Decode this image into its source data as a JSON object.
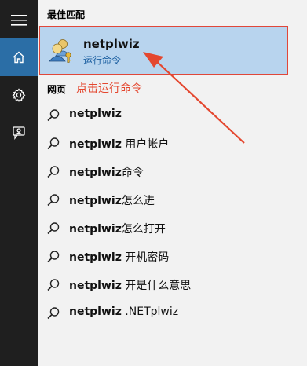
{
  "sections": {
    "best_match": "最佳匹配",
    "web": "网页"
  },
  "best_match": {
    "title": "netplwiz",
    "subtitle": "运行命令"
  },
  "annotation": "点击运行命令",
  "results": [
    {
      "query": "netplwiz",
      "rest": ""
    },
    {
      "query": "netplwiz",
      "rest": " 用户帐户"
    },
    {
      "query": "netplwiz",
      "rest": "命令"
    },
    {
      "query": "netplwiz",
      "rest": "怎么进"
    },
    {
      "query": "netplwiz",
      "rest": "怎么打开"
    },
    {
      "query": "netplwiz",
      "rest": " 开机密码"
    },
    {
      "query": "netplwiz",
      "rest": " 开是什么意思"
    },
    {
      "query": "netplwiz",
      "rest": " .NETplwiz"
    }
  ],
  "rail": {
    "items": [
      {
        "icon": "hamburger-menu-icon",
        "active": false
      },
      {
        "icon": "home-icon",
        "active": true
      },
      {
        "icon": "gear-icon",
        "active": false
      },
      {
        "icon": "feedback-person-icon",
        "active": false
      }
    ]
  },
  "colors": {
    "rail_bg": "#1f1f1f",
    "rail_active": "#2b6ea6",
    "selection_bg": "#b8d4ee",
    "annotation_red": "#e4472f"
  }
}
